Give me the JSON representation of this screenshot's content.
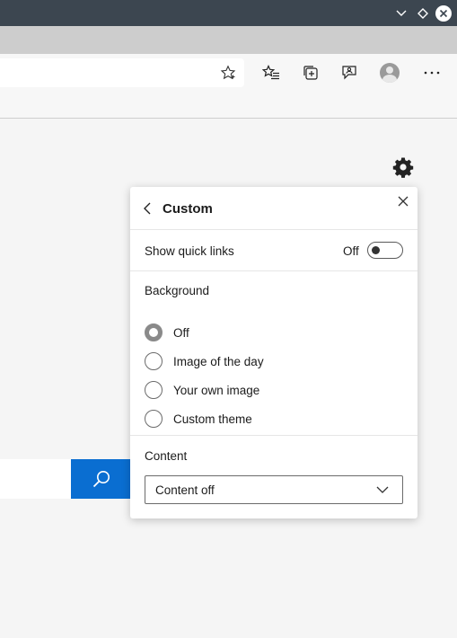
{
  "window": {
    "controls": [
      "chevron-down-icon",
      "diamond-icon",
      "close-icon"
    ]
  },
  "toolbar": {
    "icons": [
      "star-icon",
      "favorites-icon",
      "collections-icon",
      "feedback-icon",
      "profile-avatar",
      "more-icon"
    ],
    "more_label": "···"
  },
  "panel": {
    "title": "Custom",
    "quick_links": {
      "label": "Show quick links",
      "state": "Off"
    },
    "background": {
      "heading": "Background",
      "options": [
        {
          "label": "Off",
          "selected": true
        },
        {
          "label": "Image of the day",
          "selected": false
        },
        {
          "label": "Your own image",
          "selected": false
        },
        {
          "label": "Custom theme",
          "selected": false
        }
      ]
    },
    "content": {
      "heading": "Content",
      "selected_value": "Content off"
    }
  },
  "colors": {
    "titlebar": "#3c4650",
    "search_button": "#0a6ed1"
  }
}
